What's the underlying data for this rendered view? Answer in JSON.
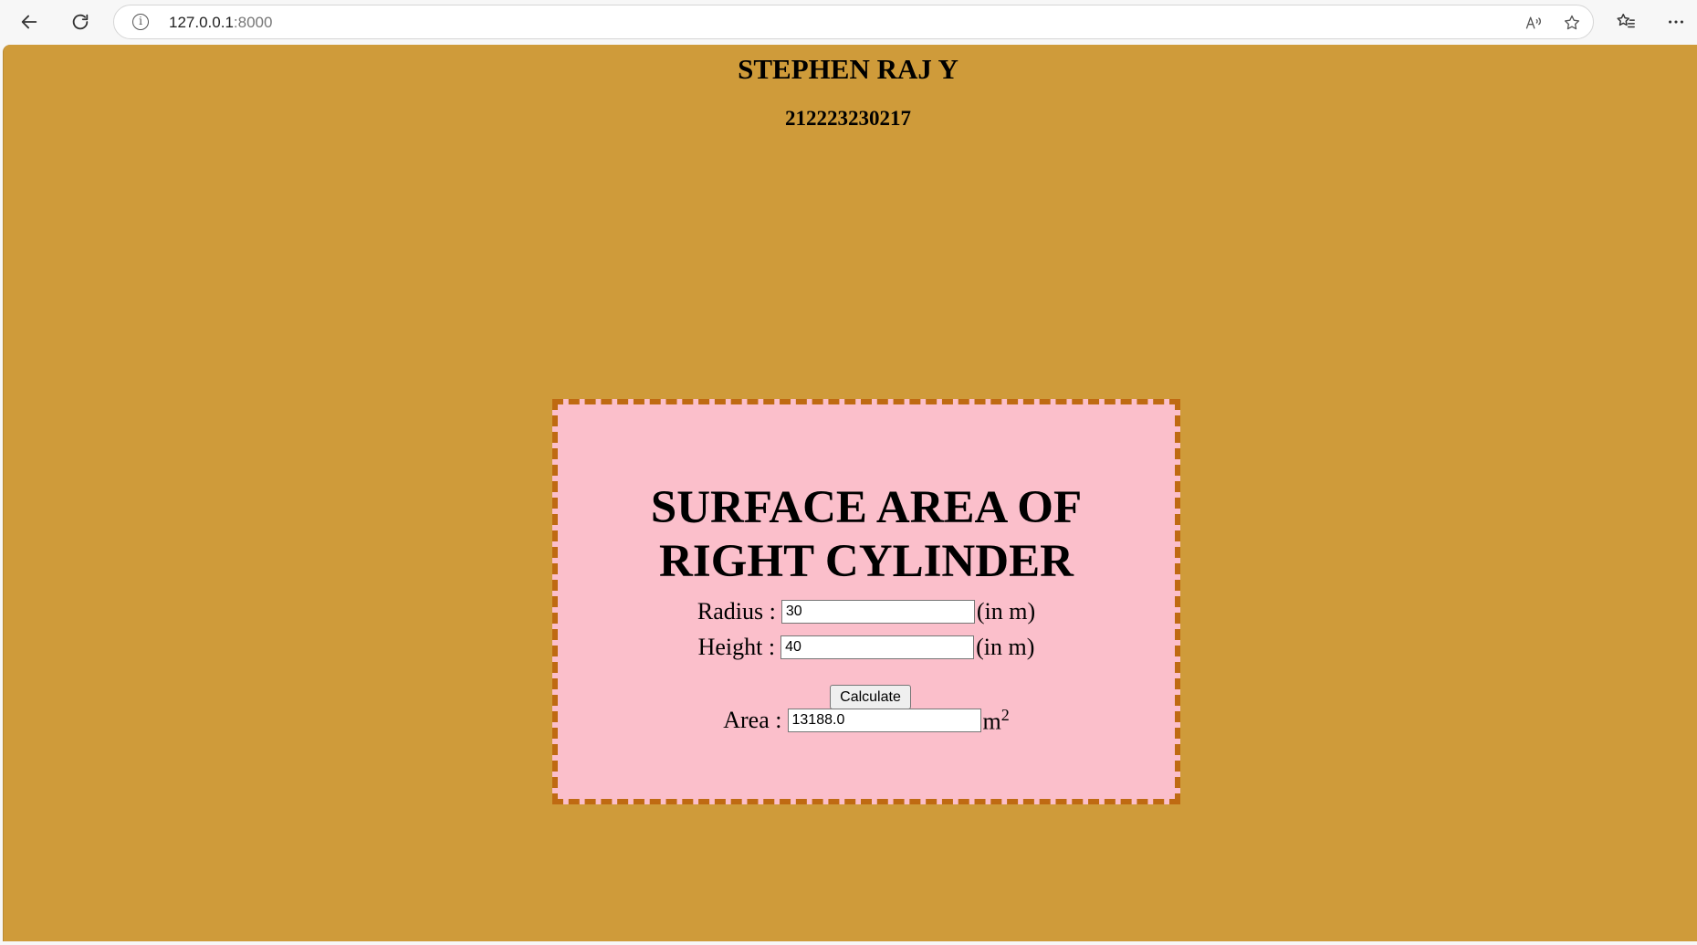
{
  "browser": {
    "url_host": "127.0.0.1",
    "url_port": ":8000",
    "icons": {
      "back": "back-arrow-icon",
      "reload": "reload-icon",
      "info": "info-icon",
      "read_aloud": "read-aloud-icon",
      "favorite": "star-icon",
      "favorites_list": "favorites-icon",
      "menu": "more-icon"
    }
  },
  "page": {
    "background_color": "#cf9b3a",
    "student_name": "STEPHEN RAJ Y",
    "student_id": "212223230217"
  },
  "card": {
    "background_color": "#fbbfcb",
    "border_color": "#bf6a12",
    "title_line1": "SURFACE AREA OF",
    "title_line2": "RIGHT CYLINDER",
    "radius_label": "Radius :",
    "radius_value": "30",
    "radius_unit": "(in m)",
    "height_label": "Height :",
    "height_value": "40",
    "height_unit": "(in m)",
    "calculate_label": "Calculate",
    "area_label": "Area :",
    "area_value": "13188.0",
    "area_unit": "m",
    "area_unit_exponent": "2"
  }
}
